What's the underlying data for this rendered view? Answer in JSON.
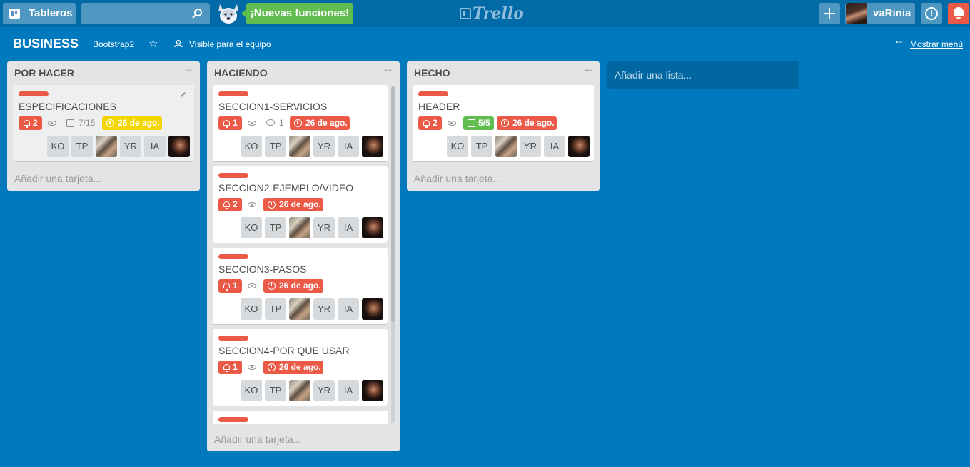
{
  "header": {
    "boards_label": "Tableros",
    "search_placeholder": "",
    "new_features_label": "¡Nuevas funciones!",
    "logo_text": "Trello",
    "user_name": "vaRinia"
  },
  "board": {
    "name": "BUSINESS",
    "team": "Bootstrap2",
    "visibility": "Visible para el equipo",
    "show_menu": "Mostrar menú"
  },
  "lists": [
    {
      "title": "POR HACER",
      "add_card": "Añadir una tarjeta...",
      "cards": [
        {
          "title": "ESPECIFICACIONES",
          "label_color": "#eb5a46",
          "notifications": "2",
          "checklist": "7/15",
          "due": "26 de ago.",
          "due_color": "#f2d600",
          "members": [
            "KO",
            "TP",
            "",
            "YR",
            "IA",
            ""
          ]
        }
      ]
    },
    {
      "title": "HACIENDO",
      "add_card": "Añadir una tarjeta...",
      "cards": [
        {
          "title": "SECCION1-SERVICIOS",
          "label_color": "#eb5a46",
          "notifications": "1",
          "comments": "1",
          "due": "26 de ago.",
          "due_color": "#eb5a46",
          "members": [
            "KO",
            "TP",
            "",
            "YR",
            "IA",
            ""
          ]
        },
        {
          "title": "SECCION2-EJEMPLO/VIDEO",
          "label_color": "#eb5a46",
          "notifications": "2",
          "due": "26 de ago.",
          "due_color": "#eb5a46",
          "members": [
            "KO",
            "TP",
            "",
            "YR",
            "IA",
            ""
          ]
        },
        {
          "title": "SECCION3-PASOS",
          "label_color": "#eb5a46",
          "notifications": "1",
          "due": "26 de ago.",
          "due_color": "#eb5a46",
          "members": [
            "KO",
            "TP",
            "",
            "YR",
            "IA",
            ""
          ]
        },
        {
          "title": "SECCION4-POR QUE USAR",
          "label_color": "#eb5a46",
          "notifications": "1",
          "due": "26 de ago.",
          "due_color": "#eb5a46",
          "members": [
            "KO",
            "TP",
            "",
            "YR",
            "IA",
            ""
          ]
        }
      ]
    },
    {
      "title": "HECHO",
      "add_card": "Añadir una tarjeta...",
      "cards": [
        {
          "title": "HEADER",
          "label_color": "#eb5a46",
          "notifications": "2",
          "checklist": "5/5",
          "due": "26 de ago.",
          "due_color": "#eb5a46",
          "members": [
            "KO",
            "TP",
            "",
            "YR",
            "IA",
            ""
          ]
        }
      ]
    }
  ],
  "add_list": "Añadir una lista...",
  "colors": {
    "board_bg": "#0079bf",
    "header_bg": "#026aa7",
    "accent_green": "#61bd4f",
    "accent_red": "#eb5a46",
    "accent_yellow": "#f2d600"
  }
}
